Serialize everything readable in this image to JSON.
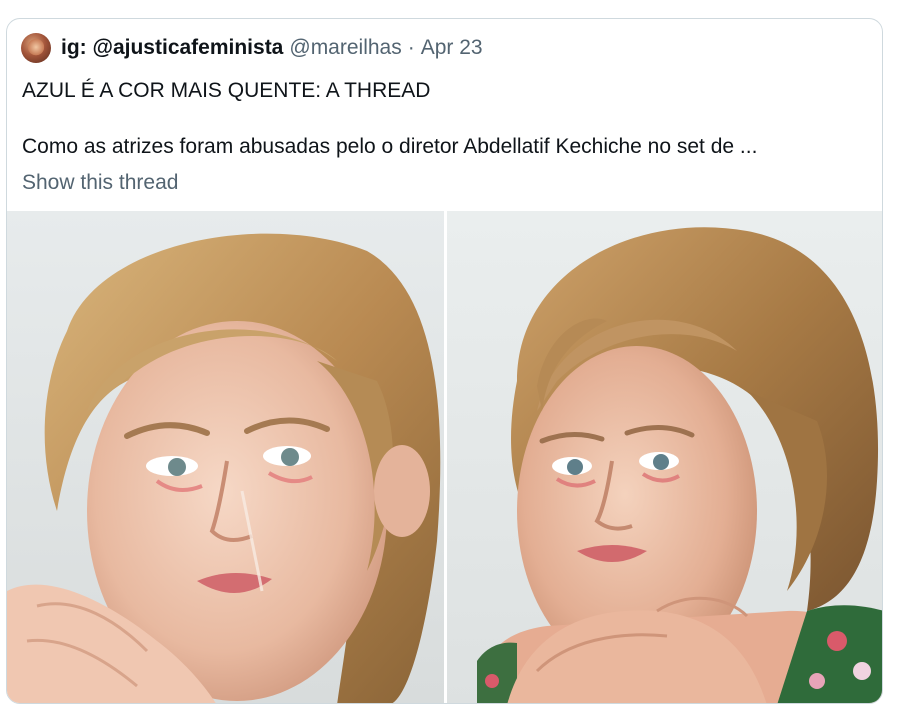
{
  "tweet": {
    "display_name": "ig: @ajusticafeminista",
    "handle": "@mareilhas",
    "separator": "·",
    "date": "Apr 23",
    "text_line1": "AZUL É A COR MAIS QUENTE: A THREAD",
    "text_line2": "Como as atrizes foram abusadas pelo o diretor Abdellatif Kechiche no set de ...",
    "show_thread": "Show this thread"
  },
  "media": {
    "photos": [
      {
        "icon": "crying-actress-photo-left"
      },
      {
        "icon": "crying-actress-photo-right"
      }
    ]
  },
  "colors": {
    "border": "#cfd9de",
    "muted": "#536471",
    "text": "#0f1419"
  }
}
